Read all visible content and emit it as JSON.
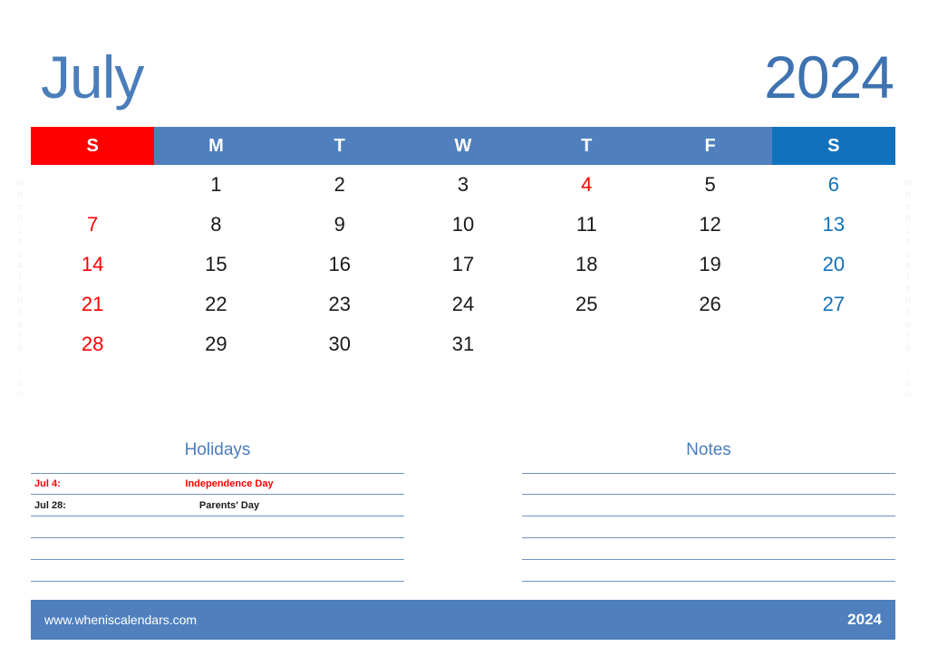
{
  "title": {
    "month": "July",
    "year": "2024"
  },
  "weekdays": [
    {
      "label": "S",
      "kind": "sun"
    },
    {
      "label": "M",
      "kind": "weekday"
    },
    {
      "label": "T",
      "kind": "weekday"
    },
    {
      "label": "W",
      "kind": "weekday"
    },
    {
      "label": "T",
      "kind": "weekday"
    },
    {
      "label": "F",
      "kind": "weekday"
    },
    {
      "label": "S",
      "kind": "sat"
    }
  ],
  "days": [
    {
      "n": "",
      "kind": "empty"
    },
    {
      "n": "1",
      "kind": "weekday"
    },
    {
      "n": "2",
      "kind": "weekday"
    },
    {
      "n": "3",
      "kind": "weekday"
    },
    {
      "n": "4",
      "kind": "holiday"
    },
    {
      "n": "5",
      "kind": "weekday"
    },
    {
      "n": "6",
      "kind": "sat"
    },
    {
      "n": "7",
      "kind": "sun"
    },
    {
      "n": "8",
      "kind": "weekday"
    },
    {
      "n": "9",
      "kind": "weekday"
    },
    {
      "n": "10",
      "kind": "weekday"
    },
    {
      "n": "11",
      "kind": "weekday"
    },
    {
      "n": "12",
      "kind": "weekday"
    },
    {
      "n": "13",
      "kind": "sat"
    },
    {
      "n": "14",
      "kind": "sun"
    },
    {
      "n": "15",
      "kind": "weekday"
    },
    {
      "n": "16",
      "kind": "weekday"
    },
    {
      "n": "17",
      "kind": "weekday"
    },
    {
      "n": "18",
      "kind": "weekday"
    },
    {
      "n": "19",
      "kind": "weekday"
    },
    {
      "n": "20",
      "kind": "sat"
    },
    {
      "n": "21",
      "kind": "sun"
    },
    {
      "n": "22",
      "kind": "weekday"
    },
    {
      "n": "23",
      "kind": "weekday"
    },
    {
      "n": "24",
      "kind": "weekday"
    },
    {
      "n": "25",
      "kind": "weekday"
    },
    {
      "n": "26",
      "kind": "weekday"
    },
    {
      "n": "27",
      "kind": "sat"
    },
    {
      "n": "28",
      "kind": "sun"
    },
    {
      "n": "29",
      "kind": "weekday"
    },
    {
      "n": "30",
      "kind": "weekday"
    },
    {
      "n": "31",
      "kind": "weekday"
    },
    {
      "n": "",
      "kind": "empty"
    },
    {
      "n": "",
      "kind": "empty"
    },
    {
      "n": "",
      "kind": "empty"
    }
  ],
  "holidays": {
    "heading": "Holidays",
    "rows": [
      {
        "date": "Jul 4:",
        "name": "Independence Day",
        "red": true
      },
      {
        "date": "Jul 28:",
        "name": "Parents' Day",
        "red": false
      },
      {
        "date": "",
        "name": "",
        "red": false
      },
      {
        "date": "",
        "name": "",
        "red": false
      },
      {
        "date": "",
        "name": "",
        "red": false
      }
    ]
  },
  "notes": {
    "heading": "Notes",
    "rows": [
      {
        "text": ""
      },
      {
        "text": ""
      },
      {
        "text": ""
      },
      {
        "text": ""
      },
      {
        "text": ""
      }
    ]
  },
  "footer": {
    "url": "www.wheniscalendars.com",
    "year": "2024"
  },
  "watermark": {
    "text": "wheniscalendars.com"
  },
  "colors": {
    "header_weekday": "#4f80bd",
    "header_sunday": "#ff0000",
    "header_saturday": "#1072bc",
    "title_blue": "#4a7ebb",
    "sunday_text": "#ff0000",
    "saturday_text": "#1072bc",
    "rule_line": "#6f93c4",
    "footer_bar": "#4f80bd"
  }
}
